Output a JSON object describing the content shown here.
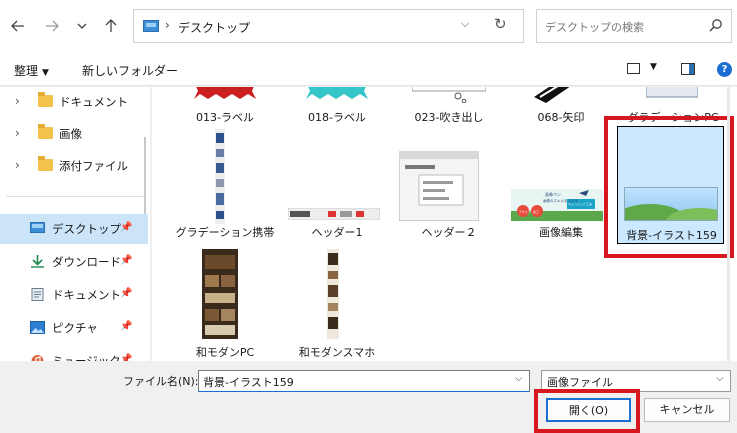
{
  "nav": {
    "back_icon": "arrow-left-icon",
    "forward_icon": "arrow-right-icon",
    "recent_icon": "chevron-down-icon",
    "up_icon": "arrow-up-icon"
  },
  "address": {
    "separator": "›",
    "path": "デスクトップ",
    "dropdown": "⌵",
    "refresh": "↻"
  },
  "search": {
    "placeholder": "デスクトップの検索"
  },
  "toolbar": {
    "organize_label": "整理",
    "organize_caret": "▼",
    "new_folder_label": "新しいフォルダー",
    "view_caret": "▼",
    "help_label": "?"
  },
  "sidebar": {
    "items": [
      {
        "label": "ドキュメント",
        "chev": "›"
      },
      {
        "label": "画像",
        "chev": "›"
      },
      {
        "label": "添付ファイル",
        "chev": "›"
      }
    ],
    "quick": [
      {
        "label": "デスクトップ",
        "pin": "📌"
      },
      {
        "label": "ダウンロード",
        "pin": "📌"
      },
      {
        "label": "ドキュメント",
        "pin": "📌"
      },
      {
        "label": "ピクチャ",
        "pin": "📌"
      },
      {
        "label": "ミュージック",
        "pin": "📌"
      }
    ]
  },
  "files": {
    "row1": [
      "013-ラベル",
      "018-ラベル",
      "023-吹き出し",
      "068-矢印",
      "グラデーションPC"
    ],
    "row2": [
      "グラデーション携帯",
      "ヘッダー1",
      "ヘッダー２",
      "画像編集"
    ],
    "row3": [
      "和モダンPC",
      "和モダンスマホ"
    ],
    "selected": "背景-イラスト159",
    "thumb_text": {
      "gazou_title": "画像ペン",
      "gazou_sub": "画像のスキルを上げる",
      "gazou_b1": "デザイン",
      "gazou_b2": "加工",
      "gazou_b3": "ちょっとした工夫"
    }
  },
  "bottom": {
    "filename_label": "ファイル名(N):",
    "filename_value": "背景-イラスト159",
    "filetype_value": "画像ファイル",
    "dropdown": "⌵",
    "open_label": "開く(O)",
    "cancel_label": "キャンセル"
  },
  "colors": {
    "accent": "#1c6fd1",
    "selection": "#cce8ff",
    "highlight_box": "#d6171f",
    "folder": "#f2c24b"
  }
}
